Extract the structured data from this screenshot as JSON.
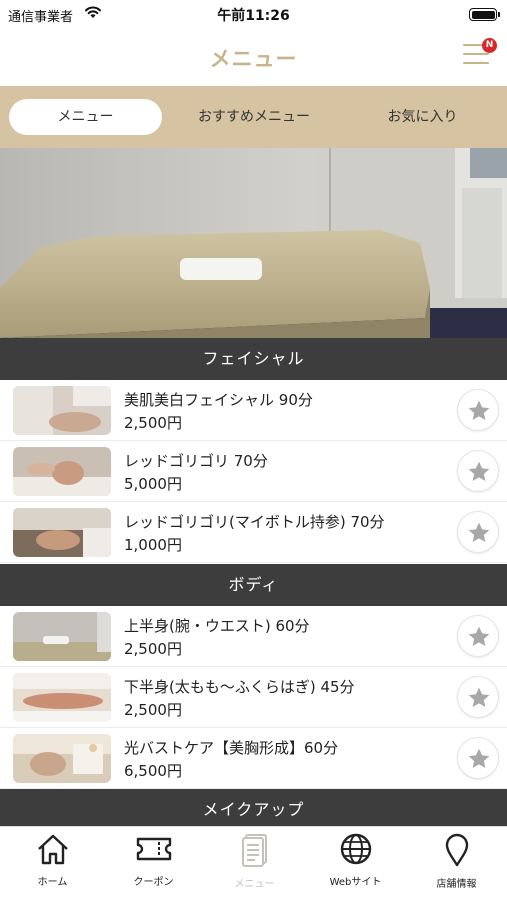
{
  "status_bar": {
    "carrier": "通信事業者",
    "time": "午前11:26"
  },
  "nav": {
    "title": "メニュー",
    "badge": "N"
  },
  "tabs": [
    {
      "label": "メニュー",
      "active": true
    },
    {
      "label": "おすすめメニュー",
      "active": false
    },
    {
      "label": "お気に入り",
      "active": false
    }
  ],
  "sections": [
    {
      "title": "フェイシャル",
      "items": [
        {
          "name": "美肌美白フェイシャル 90分",
          "price": "2,500円"
        },
        {
          "name": "レッドゴリゴリ 70分",
          "price": "5,000円"
        },
        {
          "name": "レッドゴリゴリ(マイボトル持参) 70分",
          "price": "1,000円"
        }
      ]
    },
    {
      "title": "ボディ",
      "items": [
        {
          "name": "上半身(腕・ウエスト) 60分",
          "price": "2,500円"
        },
        {
          "name": "下半身(太もも～ふくらはぎ) 45分",
          "price": "2,500円"
        },
        {
          "name": "光バストケア【美胸形成】60分",
          "price": "6,500円"
        }
      ]
    },
    {
      "title": "メイクアップ",
      "items": []
    }
  ],
  "tab_bar": [
    {
      "label": "ホーム",
      "icon": "home-icon",
      "active": false
    },
    {
      "label": "クーポン",
      "icon": "coupon-icon",
      "active": false
    },
    {
      "label": "メニュー",
      "icon": "menu-book-icon",
      "active": true
    },
    {
      "label": "Webサイト",
      "icon": "globe-icon",
      "active": false
    },
    {
      "label": "店舗情報",
      "icon": "map-pin-icon",
      "active": false
    }
  ],
  "colors": {
    "accent": "#c8b48a",
    "tab_background": "#d6c3a1",
    "section_header": "#3d3d3d",
    "badge": "#d9262c",
    "inactive_tab_label": "#c5c0b8"
  }
}
